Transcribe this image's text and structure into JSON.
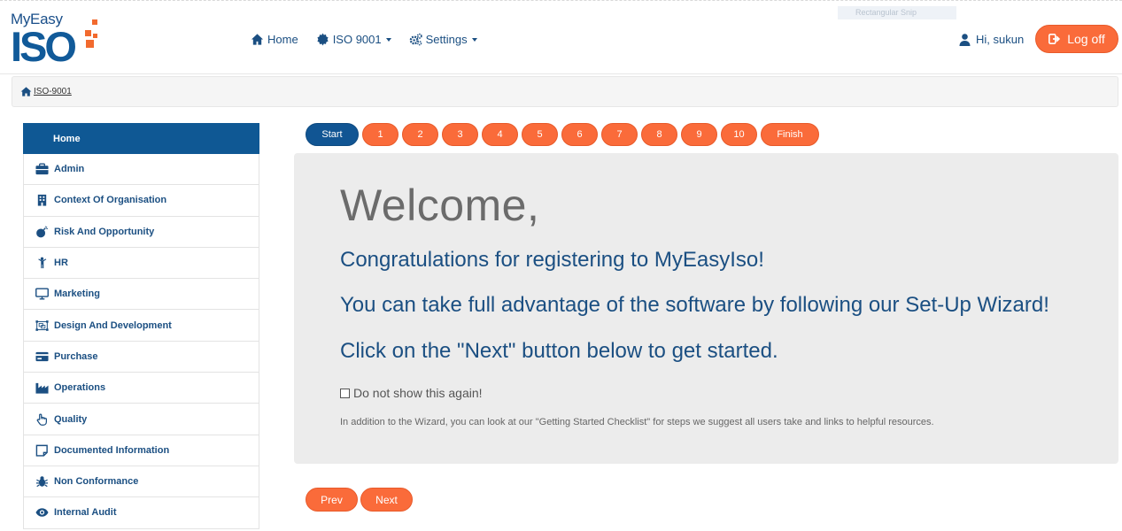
{
  "ghost_tooltip": "Rectangular Snip",
  "brand": {
    "my": "MyEasy",
    "iso": "ISO",
    "accent": "#f26a2e",
    "primary": "#115a99"
  },
  "nav": {
    "home": "Home",
    "iso": "ISO 9001",
    "settings": "Settings"
  },
  "user": {
    "greeting": "Hi, sukun",
    "logoff": "Log off"
  },
  "breadcrumb": {
    "item": "ISO-9001"
  },
  "sidebar": {
    "items": [
      {
        "label": "Home",
        "icon": "none"
      },
      {
        "label": "Admin",
        "icon": "briefcase-icon"
      },
      {
        "label": "Context Of Organisation",
        "icon": "building-icon"
      },
      {
        "label": "Risk And Opportunity",
        "icon": "bomb-icon"
      },
      {
        "label": "HR",
        "icon": "person-icon"
      },
      {
        "label": "Marketing",
        "icon": "monitor-icon"
      },
      {
        "label": "Design And Development",
        "icon": "object-group-icon"
      },
      {
        "label": "Purchase",
        "icon": "credit-card-icon"
      },
      {
        "label": "Operations",
        "icon": "industry-icon"
      },
      {
        "label": "Quality",
        "icon": "hand-pointer-icon"
      },
      {
        "label": "Documented Information",
        "icon": "sticky-note-icon"
      },
      {
        "label": "Non Conformance",
        "icon": "bug-icon"
      },
      {
        "label": "Internal Audit",
        "icon": "eye-icon"
      }
    ]
  },
  "wizard": {
    "start": "Start",
    "steps": [
      "1",
      "2",
      "3",
      "4",
      "5",
      "6",
      "7",
      "8",
      "9",
      "10"
    ],
    "finish": "Finish"
  },
  "panel": {
    "welcome": "Welcome,",
    "line1": "Congratulations for registering to MyEasyIso!",
    "line2": "You can take full advantage of the software by following our Set-Up Wizard!",
    "line3": "Click on the \"Next\" button below to get started.",
    "checkbox": "Do not show this again!",
    "note": "In addition to the Wizard, you can look at our \"Getting Started Checklist\" for steps we suggest all users take and links to helpful resources."
  },
  "pager": {
    "prev": "Prev",
    "next": "Next"
  }
}
